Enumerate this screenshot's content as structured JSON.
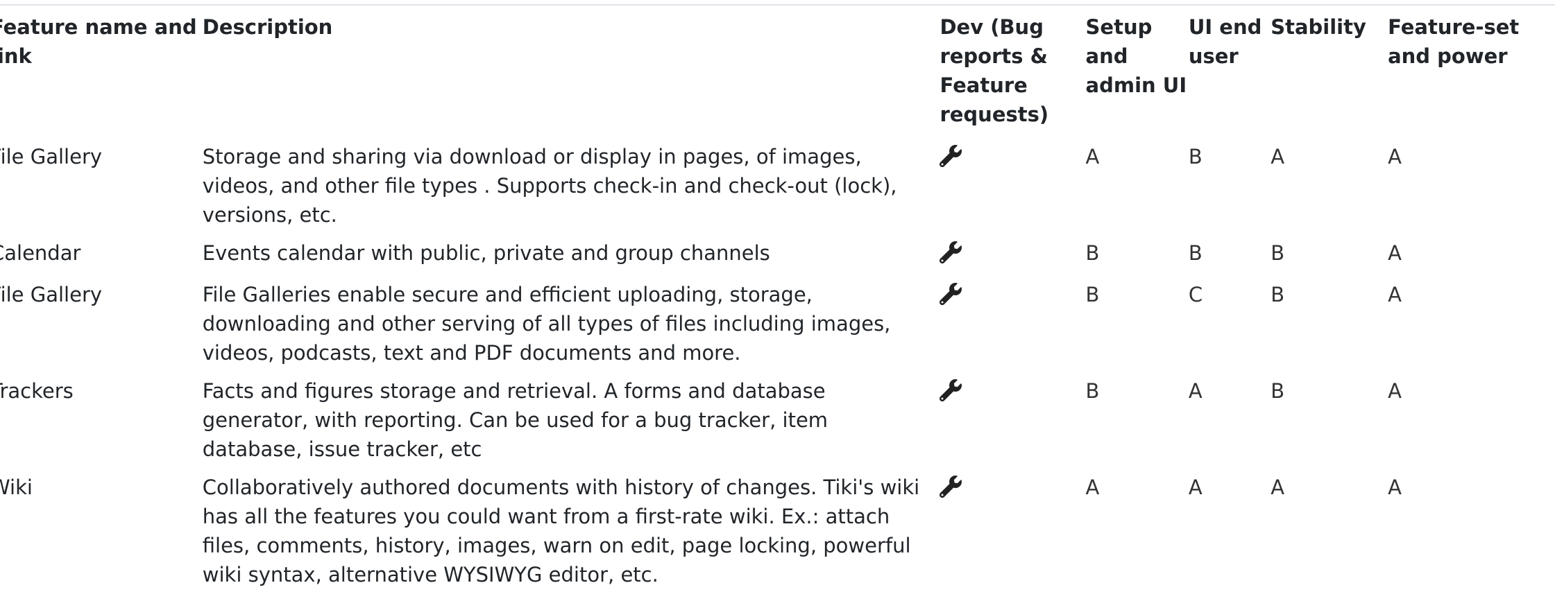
{
  "table": {
    "headers": {
      "name": "Feature name and link",
      "description": "Description",
      "dev": "Dev (Bug reports & Feature requests)",
      "setup": "Setup and admin UI",
      "ui": "UI end user",
      "stability": "Stability",
      "power": "Feature-set and power"
    },
    "rows": [
      {
        "name": "File Gallery",
        "description": "Storage and sharing via download or display in pages, of images, videos, and other file types . Supports check-in and check-out (lock), versions, etc.",
        "dev_icon": "wrench-icon",
        "setup": "A",
        "ui": "B",
        "stability": "A",
        "power": "A"
      },
      {
        "name": "Calendar",
        "description": "Events calendar with public, private and group channels",
        "dev_icon": "wrench-icon",
        "setup": "B",
        "ui": "B",
        "stability": "B",
        "power": "A"
      },
      {
        "name": "File Gallery",
        "description": "File Galleries enable secure and efficient uploading, storage, downloading and other serving of all types of files including images, videos, podcasts, text and PDF documents and more.",
        "dev_icon": "wrench-icon",
        "setup": "B",
        "ui": "C",
        "stability": "B",
        "power": "A"
      },
      {
        "name": "Trackers",
        "description": "Facts and figures storage and retrieval. A forms and database generator, with reporting. Can be used for a bug tracker, item database, issue tracker, etc",
        "dev_icon": "wrench-icon",
        "setup": "B",
        "ui": "A",
        "stability": "B",
        "power": "A"
      },
      {
        "name": "Wiki",
        "description": "Collaboratively authored documents with history of changes. Tiki's wiki has all the features you could want from a first-rate wiki. Ex.: attach files, comments, history, images, warn on edit, page locking, powerful wiki syntax, alternative WYSIWYG editor, etc.",
        "dev_icon": "wrench-icon",
        "setup": "A",
        "ui": "A",
        "stability": "A",
        "power": "A"
      }
    ]
  }
}
